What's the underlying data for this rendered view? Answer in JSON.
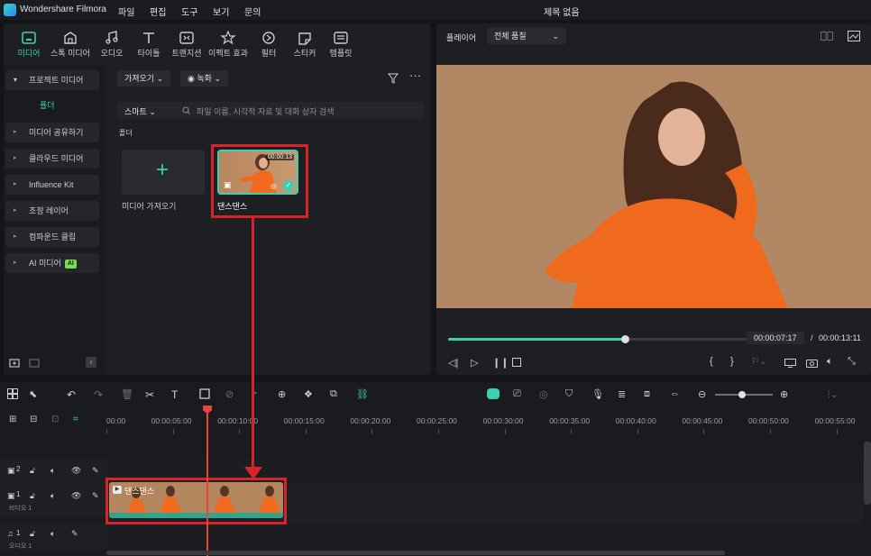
{
  "app": {
    "name": "Wondershare Filmora",
    "document_title": "제목 없음",
    "menu": [
      "파일",
      "편집",
      "도구",
      "보기",
      "문의"
    ]
  },
  "toolbar": {
    "tabs": [
      {
        "label": "미디어",
        "icon": "media-icon",
        "active": true
      },
      {
        "label": "스톡 미디어",
        "icon": "stock-media-icon"
      },
      {
        "label": "오디오",
        "icon": "music-note-icon"
      },
      {
        "label": "타이틀",
        "icon": "title-t-icon"
      },
      {
        "label": "트랜지션",
        "icon": "transition-icon"
      },
      {
        "label": "이펙트 효과",
        "icon": "effects-icon"
      },
      {
        "label": "필터",
        "icon": "filter-icon"
      },
      {
        "label": "스티커",
        "icon": "sticker-icon"
      },
      {
        "label": "템플릿",
        "icon": "template-icon"
      }
    ]
  },
  "sidebar": {
    "items": [
      {
        "label": "프로젝트 미디어",
        "open": true
      },
      {
        "label": "폴더",
        "sub": true
      },
      {
        "label": "미디어 공유하기"
      },
      {
        "label": "클라우드 미디어"
      },
      {
        "label": "Influence Kit"
      },
      {
        "label": "조정 레이어"
      },
      {
        "label": "컴파운드 클립"
      },
      {
        "label": "AI 미디어",
        "badge": "AI"
      }
    ]
  },
  "media": {
    "import_label": "가져오기",
    "record_label": "녹화",
    "smart_label": "스마트",
    "search_placeholder": "파일 이름, 시각적 자료 및 대화 상자 검색",
    "folder_label": "폴더",
    "import_card_label": "미디어 가져오기",
    "clip": {
      "name": "댄스댄스",
      "duration": "00:00:13"
    }
  },
  "player": {
    "label": "플레이어",
    "quality": "전체 품질",
    "current_time": "00:00:07:17",
    "separator": "/",
    "total_time": "00:00:13:11",
    "progress": 0.56
  },
  "timeline": {
    "ruler": [
      "00:00",
      "00:00:05:00",
      "00:00:10:00",
      "00:00:15:00",
      "00:00:20:00",
      "00:00:25:00",
      "00:00:30:00",
      "00:00:35:00",
      "00:00:40:00",
      "00:00:45:00",
      "00:00:50:00",
      "00:00:55:00"
    ],
    "tracks": [
      {
        "num": "2"
      },
      {
        "num": "1",
        "name": "비디오 1"
      },
      {
        "num": "1",
        "name": "오디오 1"
      }
    ],
    "clip_label": "댄스댄스"
  },
  "colors": {
    "accent": "#3ad0b0",
    "highlight": "#d8232a",
    "playhead": "#e8453c"
  }
}
